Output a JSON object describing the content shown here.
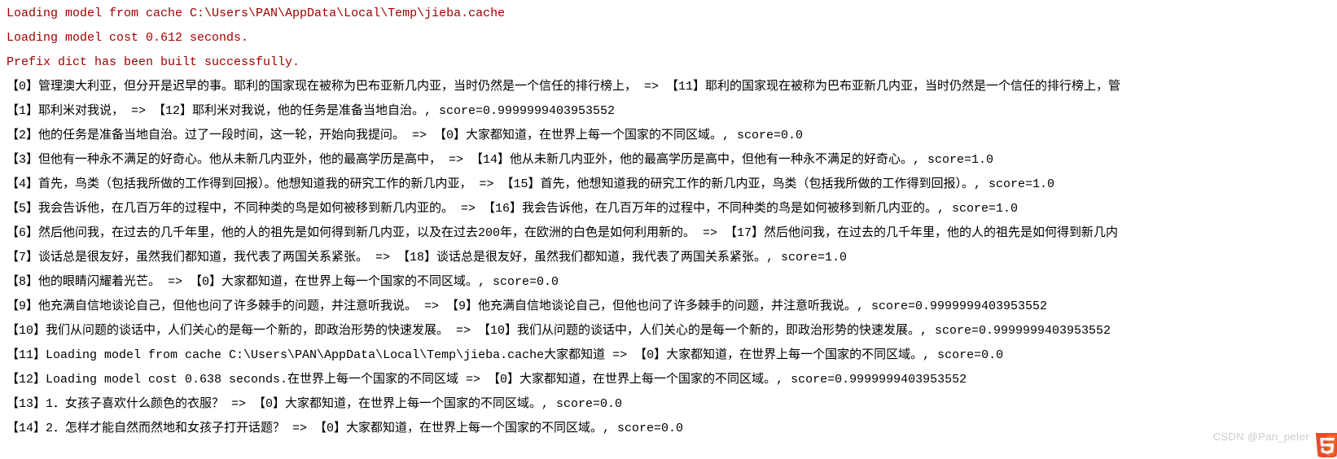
{
  "log": [
    "Loading model from cache C:\\Users\\PAN\\AppData\\Local\\Temp\\jieba.cache",
    "Loading model cost 0.612 seconds.",
    "Prefix dict has been built successfully."
  ],
  "lines": [
    "【0】管理澳大利亚，但分开是迟早的事。耶利的国家现在被称为巴布亚新几内亚，当时仍然是一个信任的排行榜上，  =>  【11】耶利的国家现在被称为巴布亚新几内亚，当时仍然是一个信任的排行榜上，管",
    "【1】耶利米对我说，  =>  【12】耶利米对我说，他的任务是准备当地自治。, score=0.9999999403953552",
    "【2】他的任务是准备当地自治。过了一段时间，这一轮，开始向我提问。  =>  【0】大家都知道，在世界上每一个国家的不同区域。, score=0.0",
    "【3】但他有一种永不满足的好奇心。他从未新几内亚外，他的最高学历是高中，  =>  【14】他从未新几内亚外，他的最高学历是高中，但他有一种永不满足的好奇心。, score=1.0",
    "【4】首先，鸟类（包括我所做的工作得到回报）。他想知道我的研究工作的新几内亚，  =>  【15】首先，他想知道我的研究工作的新几内亚，鸟类（包括我所做的工作得到回报）。, score=1.0",
    "【5】我会告诉他，在几百万年的过程中，不同种类的鸟是如何被移到新几内亚的。  =>  【16】我会告诉他，在几百万年的过程中，不同种类的鸟是如何被移到新几内亚的。, score=1.0",
    "【6】然后他问我，在过去的几千年里，他的人的祖先是如何得到新几内亚，以及在过去200年，在欧洲的白色是如何利用新的。  =>  【17】然后他问我，在过去的几千年里，他的人的祖先是如何得到新几内",
    "【7】谈话总是很友好，虽然我们都知道，我代表了两国关系紧张。  =>  【18】谈话总是很友好，虽然我们都知道，我代表了两国关系紧张。, score=1.0",
    "【8】他的眼睛闪耀着光芒。  =>  【0】大家都知道，在世界上每一个国家的不同区域。, score=0.0",
    "【9】他充满自信地谈论自己，但他也问了许多棘手的问题，并注意听我说。  =>  【9】他充满自信地谈论自己，但他也问了许多棘手的问题，并注意听我说。, score=0.9999999403953552",
    "【10】我们从问题的谈话中，人们关心的是每一个新的，即政治形势的快速发展。  =>  【10】我们从问题的谈话中，人们关心的是每一个新的，即政治形势的快速发展。, score=0.9999999403953552",
    "【11】Loading model from cache C:\\Users\\PAN\\AppData\\Local\\Temp\\jieba.cache大家都知道 =>  【0】大家都知道，在世界上每一个国家的不同区域。, score=0.0",
    "【12】Loading model cost 0.638 seconds.在世界上每一个国家的不同区域 =>  【0】大家都知道，在世界上每一个国家的不同区域。, score=0.9999999403953552",
    "【13】1．女孩子喜欢什么颜色的衣服？  =>  【0】大家都知道，在世界上每一个国家的不同区域。, score=0.0",
    "【14】2．怎样才能自然而然地和女孩子打开话题？  =>  【0】大家都知道，在世界上每一个国家的不同区域。, score=0.0"
  ],
  "watermark": "CSDN @Pan_peter"
}
